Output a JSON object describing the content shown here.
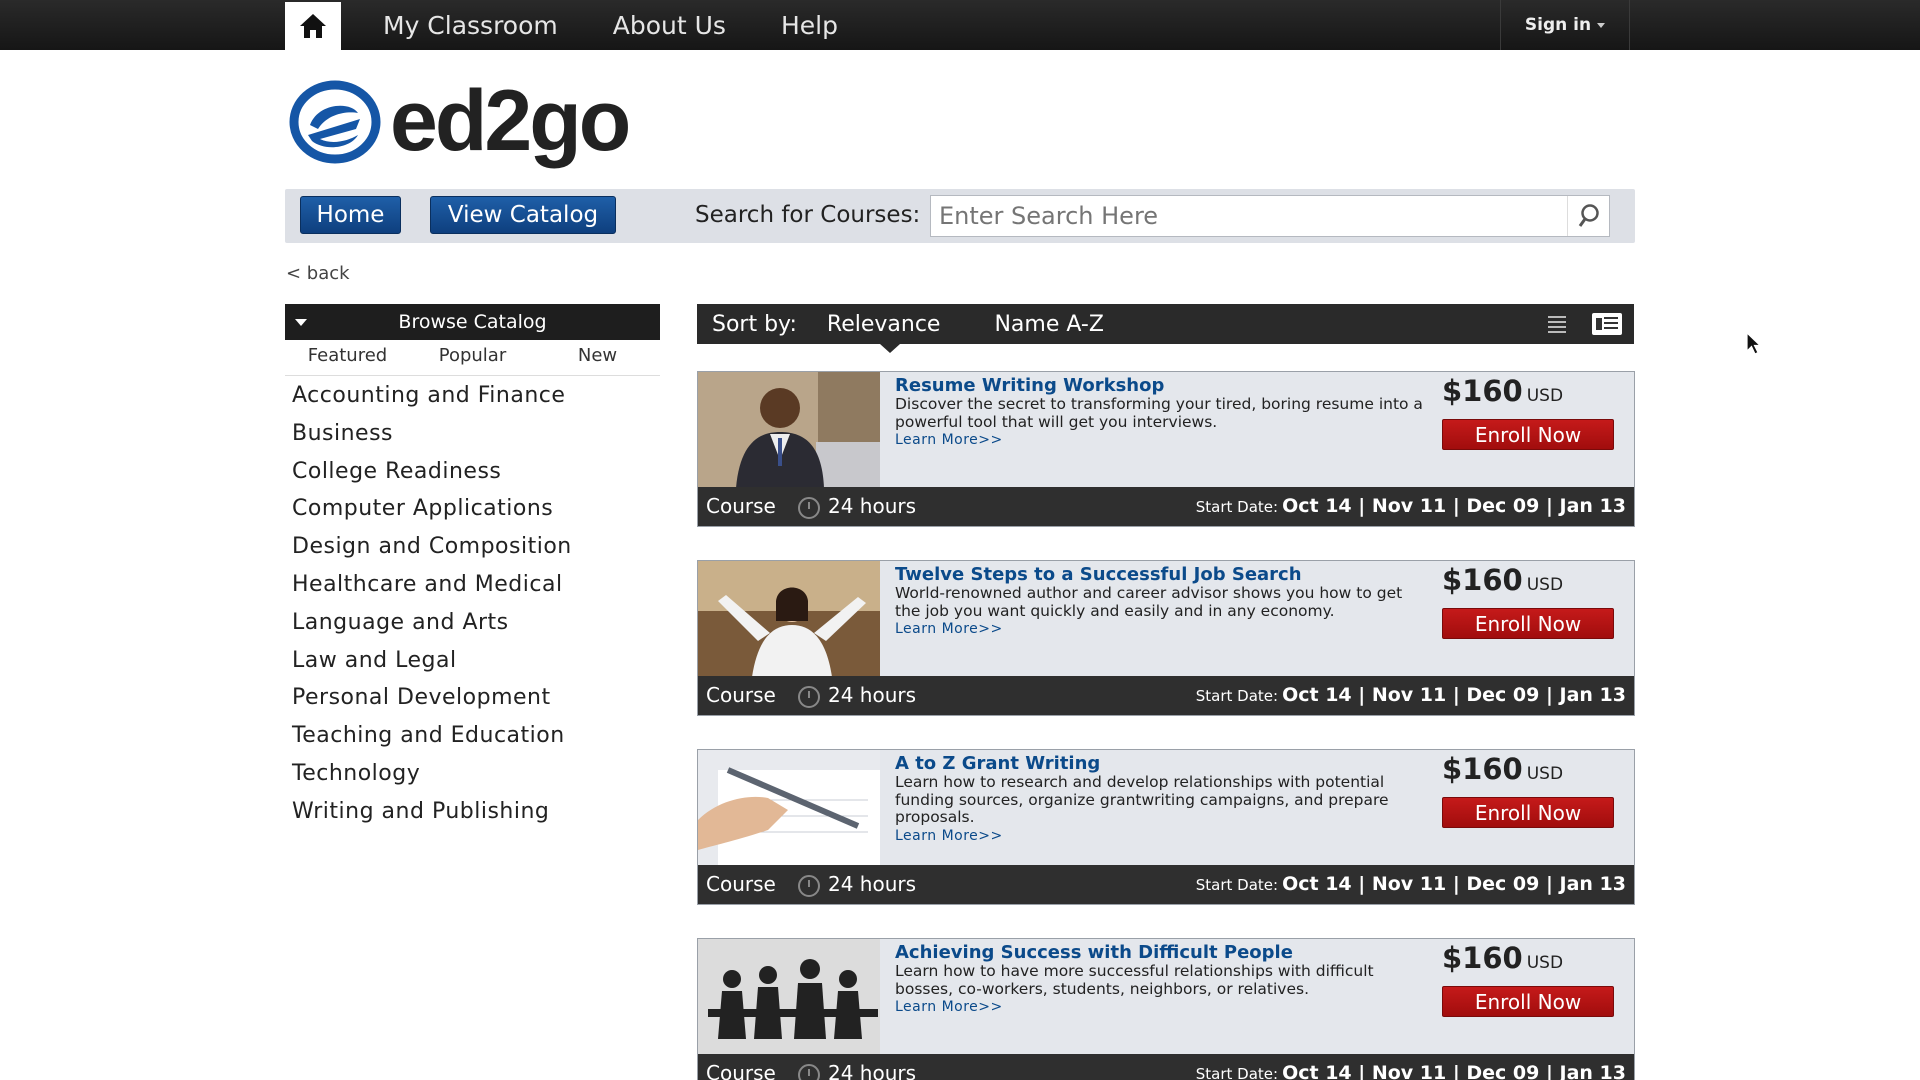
{
  "topnav": {
    "items": [
      "My Classroom",
      "About Us",
      "Help"
    ],
    "signin": "Sign in"
  },
  "logo": {
    "text": "ed2go"
  },
  "nav": {
    "home": "Home",
    "catalog": "View Catalog",
    "search_label": "Search for Courses:",
    "search_placeholder": "Enter Search Here"
  },
  "back": "< back",
  "sidebar": {
    "header": "Browse Catalog",
    "tabs": [
      "Featured",
      "Popular",
      "New"
    ],
    "categories": [
      "Accounting and Finance",
      "Business",
      "College Readiness",
      "Computer Applications",
      "Design and Composition",
      "Healthcare and Medical",
      "Language and Arts",
      "Law and Legal",
      "Personal Development",
      "Teaching and Education",
      "Technology",
      "Writing and Publishing"
    ]
  },
  "sort": {
    "label": "Sort by:",
    "options": [
      "Relevance",
      "Name A-Z"
    ]
  },
  "courses": [
    {
      "title": "Resume Writing Workshop",
      "desc": "Discover the secret to transforming your tired, boring resume into a powerful tool that will get you interviews.",
      "more": "Learn More>>",
      "price": "$160",
      "currency": "USD",
      "enroll": "Enroll Now",
      "type": "Course",
      "hours": "24 hours",
      "start_label": "Start Date:",
      "dates": "Oct 14 | Nov 11 | Dec 09 | Jan 13"
    },
    {
      "title": "Twelve Steps to a Successful Job Search",
      "desc": "World-renowned author and career advisor shows you how to get the job you want quickly and easily and in any economy.",
      "more": "Learn More>>",
      "price": "$160",
      "currency": "USD",
      "enroll": "Enroll Now",
      "type": "Course",
      "hours": "24 hours",
      "start_label": "Start Date:",
      "dates": "Oct 14 | Nov 11 | Dec 09 | Jan 13"
    },
    {
      "title": "A to Z Grant Writing",
      "desc": "Learn how to research and develop relationships with potential funding sources, organize grantwriting campaigns, and prepare proposals.",
      "more": "Learn More>>",
      "price": "$160",
      "currency": "USD",
      "enroll": "Enroll Now",
      "type": "Course",
      "hours": "24 hours",
      "start_label": "Start Date:",
      "dates": "Oct 14 | Nov 11 | Dec 09 | Jan 13"
    },
    {
      "title": "Achieving Success with Difficult People",
      "desc": "Learn how to have more successful relationships with difficult bosses, co-workers, students, neighbors, or relatives.",
      "more": "Learn More>>",
      "price": "$160",
      "currency": "USD",
      "enroll": "Enroll Now",
      "type": "Course",
      "hours": "24 hours",
      "start_label": "Start Date:",
      "dates": "Oct 14 | Nov 11 | Dec 09 | Jan 13"
    }
  ]
}
